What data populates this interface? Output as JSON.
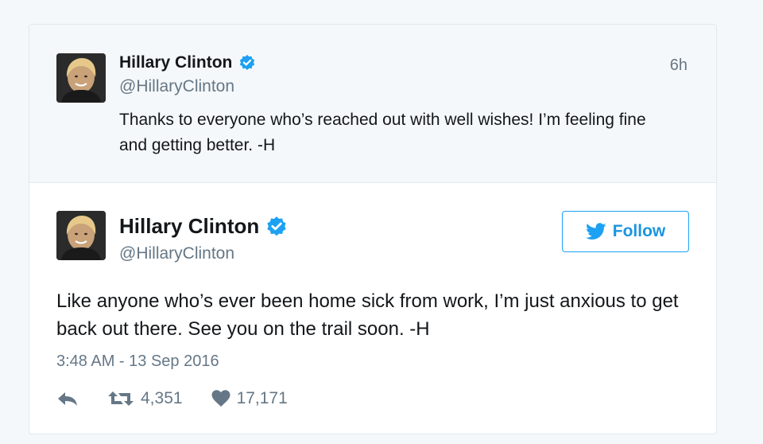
{
  "parent_tweet": {
    "author_name": "Hillary Clinton",
    "handle": "@HillaryClinton",
    "time_ago": "6h",
    "text": "Thanks to everyone who’s reached out with well wishes! I’m feeling fine and getting better. -H"
  },
  "main_tweet": {
    "author_name": "Hillary Clinton",
    "handle": "@HillaryClinton",
    "follow_label": "Follow",
    "text": "Like anyone who’s ever been home sick from work, I’m just anxious to get back out there. See you on the trail soon. -H",
    "timestamp": "3:48 AM - 13 Sep 2016",
    "retweet_count": "4,351",
    "like_count": "17,171"
  },
  "icons": {
    "verified": "verified-badge-icon",
    "twitter_bird": "twitter-bird-icon",
    "reply": "reply-icon",
    "retweet": "retweet-icon",
    "like": "heart-icon"
  },
  "colors": {
    "accent": "#1da1f2",
    "text": "#14171a",
    "muted": "#657786",
    "parent_bg": "#f5f8fa",
    "border": "#e1e8ed"
  }
}
